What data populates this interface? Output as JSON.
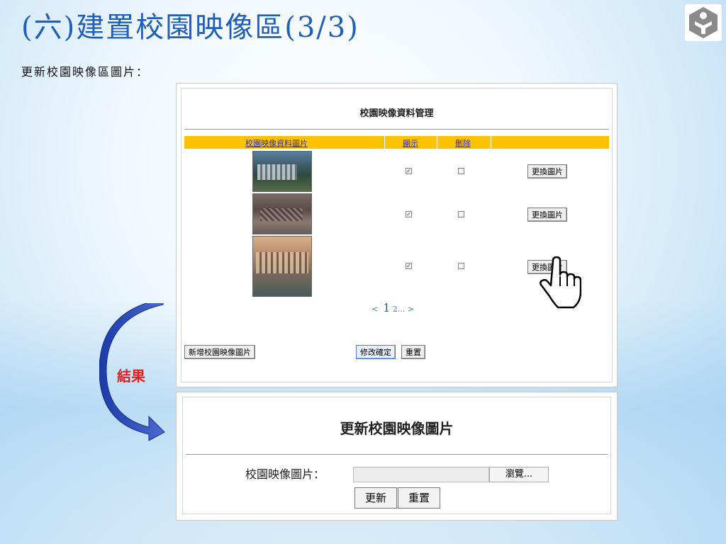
{
  "slide": {
    "title": "(六)建置校園映像區(3/3)",
    "subtitle": "更新校園映像區圖片：",
    "result_label": "結果"
  },
  "panel1": {
    "title": "校園映像資料管理",
    "columns": [
      "校園映像資料圖片",
      "顯示",
      "刪除"
    ],
    "rows": [
      {
        "thumbnail": "campus-building-photo",
        "show": true,
        "delete": false,
        "replace_label": "更換圖片"
      },
      {
        "thumbnail": "construction-site-photo",
        "show": true,
        "delete": false,
        "replace_label": "更換圖片"
      },
      {
        "thumbnail": "school-building-photo",
        "show": true,
        "delete": false,
        "replace_label": "更換圖片"
      }
    ],
    "pagination": {
      "prev": "<",
      "current": "1",
      "next_pages": "2...",
      "next": ">"
    },
    "add_button": "新增校園映像圖片",
    "confirm_button": "修改確定",
    "reset_button": "重置"
  },
  "panel2": {
    "title": "更新校園映像圖片",
    "field_label": "校園映像圖片：",
    "file_value": "",
    "browse_button": "瀏覽...",
    "update_button": "更新",
    "reset_button": "重置"
  },
  "colors": {
    "title_blue": "#1f5fb8",
    "header_yellow": "#fdc300",
    "result_red": "#e02020",
    "arrow_blue": "#2f4fc0"
  }
}
